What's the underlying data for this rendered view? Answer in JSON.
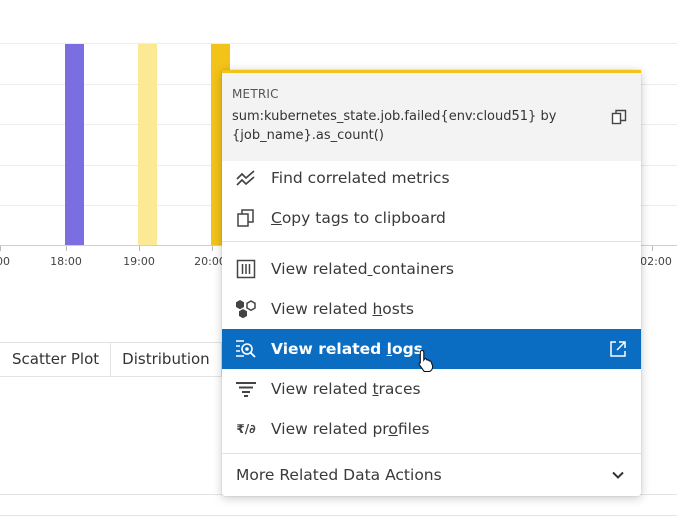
{
  "chart_data": {
    "type": "bar",
    "categories": [
      "18:00",
      "19:00",
      "20:00"
    ],
    "bar_colors": [
      "#7b6ee0",
      "#fbe994",
      "#f2c318"
    ],
    "x_ticks": [
      "00",
      "18:00",
      "19:00",
      "20:00",
      "02:00"
    ]
  },
  "tabs": [
    "Scatter Plot",
    "Distribution"
  ],
  "popup": {
    "header_label": "METRIC",
    "metric_query": "sum:kubernetes_state.job.failed{env:cloud51} by {job_name}.as_count()",
    "items": [
      {
        "label": "Find correlated metrics",
        "icon": "correlation-icon"
      },
      {
        "label": "Copy tags to clipboard",
        "icon": "copy-icon"
      },
      {
        "label": "View related containers",
        "icon": "containers-icon"
      },
      {
        "label": "View related hosts",
        "icon": "hosts-icon"
      },
      {
        "label": "View related logs",
        "icon": "logs-icon"
      },
      {
        "label": "View related traces",
        "icon": "traces-icon"
      },
      {
        "label": "View related profiles",
        "icon": "profiles-icon"
      }
    ],
    "more_label": "More Related Data Actions"
  },
  "colors": {
    "accent": "#0b6dc2",
    "popup_top_border": "#f2c318"
  }
}
